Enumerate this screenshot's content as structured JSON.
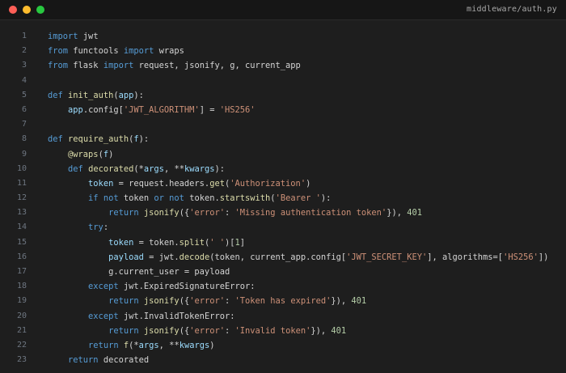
{
  "window": {
    "filename": "middleware/auth.py",
    "controls": {
      "close_color": "#ff5f57",
      "minimize_color": "#febc2e",
      "maximize_color": "#28c840"
    }
  },
  "editor": {
    "colors": {
      "background": "#1e1e1e",
      "keyword": "#569cd6",
      "function": "#dcdcaa",
      "string": "#ce9178",
      "number": "#b5cea8",
      "identifier": "#9cdcfe",
      "line_number": "#6e7681"
    },
    "lines": [
      {
        "n": "1",
        "indent": "",
        "tokens": [
          [
            "kw",
            "import"
          ],
          [
            "pl",
            " jwt"
          ]
        ]
      },
      {
        "n": "2",
        "indent": "",
        "tokens": [
          [
            "kw",
            "from"
          ],
          [
            "pl",
            " functools "
          ],
          [
            "kw",
            "import"
          ],
          [
            "pl",
            " wraps"
          ]
        ]
      },
      {
        "n": "3",
        "indent": "",
        "tokens": [
          [
            "kw",
            "from"
          ],
          [
            "pl",
            " flask "
          ],
          [
            "kw",
            "import"
          ],
          [
            "pl",
            " request, jsonify, g, current_app"
          ]
        ]
      },
      {
        "n": "4",
        "indent": "",
        "tokens": []
      },
      {
        "n": "5",
        "indent": "",
        "tokens": [
          [
            "kw",
            "def"
          ],
          [
            "pl",
            " "
          ],
          [
            "fn",
            "init_auth"
          ],
          [
            "pl",
            "("
          ],
          [
            "id",
            "app"
          ],
          [
            "pl",
            "):"
          ]
        ]
      },
      {
        "n": "6",
        "indent": "    ",
        "tokens": [
          [
            "id",
            "app"
          ],
          [
            "pl",
            ".config["
          ],
          [
            "str",
            "'JWT_ALGORITHM'"
          ],
          [
            "pl",
            "] = "
          ],
          [
            "str",
            "'HS256'"
          ]
        ]
      },
      {
        "n": "7",
        "indent": "",
        "tokens": []
      },
      {
        "n": "8",
        "indent": "",
        "tokens": [
          [
            "kw",
            "def"
          ],
          [
            "pl",
            " "
          ],
          [
            "fn",
            "require_auth"
          ],
          [
            "pl",
            "("
          ],
          [
            "id",
            "f"
          ],
          [
            "pl",
            "):"
          ]
        ]
      },
      {
        "n": "9",
        "indent": "    ",
        "tokens": [
          [
            "dec",
            "@wraps"
          ],
          [
            "pl",
            "("
          ],
          [
            "id",
            "f"
          ],
          [
            "pl",
            ")"
          ]
        ]
      },
      {
        "n": "10",
        "indent": "    ",
        "tokens": [
          [
            "kw",
            "def"
          ],
          [
            "pl",
            " "
          ],
          [
            "fn",
            "decorated"
          ],
          [
            "pl",
            "(*"
          ],
          [
            "id",
            "args"
          ],
          [
            "pl",
            ", **"
          ],
          [
            "id",
            "kwargs"
          ],
          [
            "pl",
            "):"
          ]
        ]
      },
      {
        "n": "11",
        "indent": "        ",
        "tokens": [
          [
            "id",
            "token"
          ],
          [
            "pl",
            " = request.headers."
          ],
          [
            "fn",
            "get"
          ],
          [
            "pl",
            "("
          ],
          [
            "str",
            "'Authorization'"
          ],
          [
            "pl",
            ")"
          ]
        ]
      },
      {
        "n": "12",
        "indent": "        ",
        "tokens": [
          [
            "kw",
            "if not"
          ],
          [
            "pl",
            " token "
          ],
          [
            "kw",
            "or not"
          ],
          [
            "pl",
            " token."
          ],
          [
            "fn",
            "startswith"
          ],
          [
            "pl",
            "("
          ],
          [
            "str",
            "'Bearer '"
          ],
          [
            "pl",
            "):"
          ]
        ]
      },
      {
        "n": "13",
        "indent": "            ",
        "tokens": [
          [
            "kw",
            "return"
          ],
          [
            "pl",
            " "
          ],
          [
            "fn",
            "jsonify"
          ],
          [
            "pl",
            "({"
          ],
          [
            "str",
            "'error'"
          ],
          [
            "pl",
            ": "
          ],
          [
            "str",
            "'Missing authentication token'"
          ],
          [
            "pl",
            "}), "
          ],
          [
            "num",
            "401"
          ]
        ]
      },
      {
        "n": "14",
        "indent": "        ",
        "tokens": [
          [
            "kw",
            "try"
          ],
          [
            "pl",
            ":"
          ]
        ]
      },
      {
        "n": "15",
        "indent": "            ",
        "tokens": [
          [
            "id",
            "token"
          ],
          [
            "pl",
            " = token."
          ],
          [
            "fn",
            "split"
          ],
          [
            "pl",
            "("
          ],
          [
            "str",
            "' '"
          ],
          [
            "pl",
            ")["
          ],
          [
            "num",
            "1"
          ],
          [
            "pl",
            "]"
          ]
        ]
      },
      {
        "n": "16",
        "indent": "            ",
        "tokens": [
          [
            "id",
            "payload"
          ],
          [
            "pl",
            " = jwt."
          ],
          [
            "fn",
            "decode"
          ],
          [
            "pl",
            "(token, current_app.config["
          ],
          [
            "str",
            "'JWT_SECRET_KEY'"
          ],
          [
            "pl",
            "], algorithms=["
          ],
          [
            "str",
            "'HS256'"
          ],
          [
            "pl",
            "])"
          ]
        ]
      },
      {
        "n": "17",
        "indent": "            ",
        "tokens": [
          [
            "pl",
            "g.current_user = payload"
          ]
        ]
      },
      {
        "n": "18",
        "indent": "        ",
        "tokens": [
          [
            "kw",
            "except"
          ],
          [
            "pl",
            " jwt.ExpiredSignatureError:"
          ]
        ]
      },
      {
        "n": "19",
        "indent": "            ",
        "tokens": [
          [
            "kw",
            "return"
          ],
          [
            "pl",
            " "
          ],
          [
            "fn",
            "jsonify"
          ],
          [
            "pl",
            "({"
          ],
          [
            "str",
            "'error'"
          ],
          [
            "pl",
            ": "
          ],
          [
            "str",
            "'Token has expired'"
          ],
          [
            "pl",
            "}), "
          ],
          [
            "num",
            "401"
          ]
        ]
      },
      {
        "n": "20",
        "indent": "        ",
        "tokens": [
          [
            "kw",
            "except"
          ],
          [
            "pl",
            " jwt.InvalidTokenError:"
          ]
        ]
      },
      {
        "n": "21",
        "indent": "            ",
        "tokens": [
          [
            "kw",
            "return"
          ],
          [
            "pl",
            " "
          ],
          [
            "fn",
            "jsonify"
          ],
          [
            "pl",
            "({"
          ],
          [
            "str",
            "'error'"
          ],
          [
            "pl",
            ": "
          ],
          [
            "str",
            "'Invalid token'"
          ],
          [
            "pl",
            "}), "
          ],
          [
            "num",
            "401"
          ]
        ]
      },
      {
        "n": "22",
        "indent": "        ",
        "tokens": [
          [
            "kw",
            "return"
          ],
          [
            "pl",
            " "
          ],
          [
            "fn",
            "f"
          ],
          [
            "pl",
            "(*"
          ],
          [
            "id",
            "args"
          ],
          [
            "pl",
            ", **"
          ],
          [
            "id",
            "kwargs"
          ],
          [
            "pl",
            ")"
          ]
        ]
      },
      {
        "n": "23",
        "indent": "    ",
        "tokens": [
          [
            "kw",
            "return"
          ],
          [
            "pl",
            " decorated"
          ]
        ]
      }
    ]
  }
}
